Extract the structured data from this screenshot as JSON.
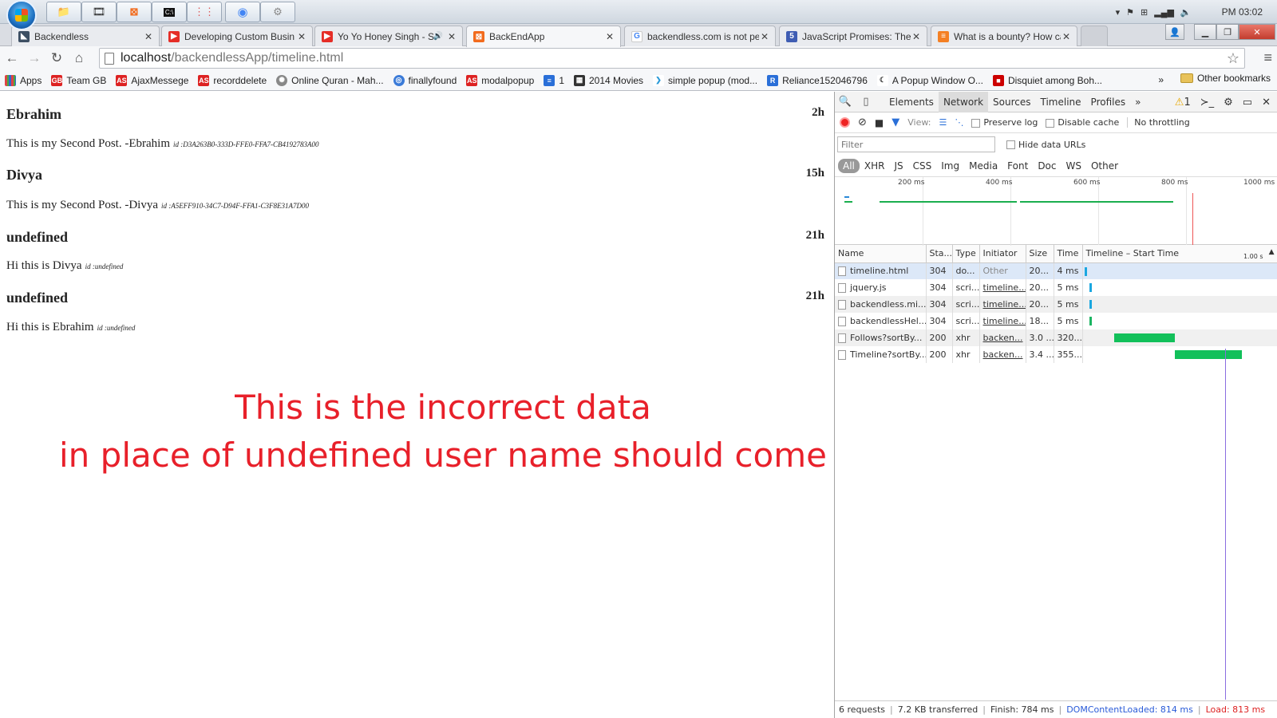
{
  "taskbar": {
    "buttons": [
      "folder-icon",
      "film-icon",
      "xampp-icon",
      "cmd-icon",
      "grid-icon",
      "chrome-icon",
      "tool-icon"
    ],
    "clock": "PM 03:02"
  },
  "tabs": [
    {
      "title": "Backendless",
      "favicon_color": "#3d4f63"
    },
    {
      "title": "Developing Custom Busin",
      "favicon_color": "#e52d27"
    },
    {
      "title": "Yo Yo Honey Singh - S",
      "favicon_color": "#e52d27"
    },
    {
      "title": "BackEndApp",
      "favicon_color": "#f26b1d"
    },
    {
      "title": "backendless.com is not pe",
      "favicon_color": "#4285f4"
    },
    {
      "title": "JavaScript Promises: There",
      "favicon_color": "#3f5db3"
    },
    {
      "title": "What is a bounty? How ca",
      "favicon_color": "#f48024"
    }
  ],
  "omnibox": {
    "host": "localhost",
    "path": "/backendlessApp/timeline.html"
  },
  "bookmarks": [
    {
      "label": "Apps",
      "color": "#d44"
    },
    {
      "label": "Team GB",
      "color": "#d22"
    },
    {
      "label": "AjaxMessege",
      "color": "#d22"
    },
    {
      "label": "recorddelete",
      "color": "#d22"
    },
    {
      "label": "Online Quran - Mah...",
      "color": "#888"
    },
    {
      "label": "finallyfound",
      "color": "#3b7bd8"
    },
    {
      "label": "modalpopup",
      "color": "#d22"
    },
    {
      "label": "1",
      "color": "#2a6fd8"
    },
    {
      "label": "2014 Movies",
      "color": "#333"
    },
    {
      "label": "simple popup (mod...",
      "color": "#2a9ad8"
    },
    {
      "label": "Reliance152046796",
      "color": "#2a6fd8"
    },
    {
      "label": "A Popup Window O...",
      "color": "#333"
    },
    {
      "label": "Disquiet among Boh...",
      "color": "#c00"
    }
  ],
  "bookmarks_other": "Other bookmarks",
  "posts": [
    {
      "name": "Ebrahim",
      "time": "2h",
      "body": "This is my Second Post. -Ebrahim",
      "id": "id :D3A263B0-333D-FFE0-FFA7-CB4192783A00"
    },
    {
      "name": "Divya",
      "time": "15h",
      "body": "This is my Second Post. -Divya",
      "id": "id :A5EFF910-34C7-D94F-FFA1-C3F8E31A7D00"
    },
    {
      "name": "undefined",
      "time": "21h",
      "body": "Hi this is Divya",
      "id": "id :undefined"
    },
    {
      "name": "undefined",
      "time": "21h",
      "body": "Hi this is Ebrahim",
      "id": "id :undefined"
    }
  ],
  "annotation": {
    "line1": "This is the incorrect data",
    "line2": "in place of undefined user name should come",
    "color": "#e8202a"
  },
  "devtools": {
    "tabs": [
      "Elements",
      "Network",
      "Sources",
      "Timeline",
      "Profiles"
    ],
    "active_tab": "Network",
    "more": "»",
    "warning_count": "1",
    "view_label": "View:",
    "preserve_log": "Preserve log",
    "disable_cache": "Disable cache",
    "throttling": "No throttling",
    "filter_placeholder": "Filter",
    "hide_data_urls": "Hide data URLs",
    "types": [
      "All",
      "XHR",
      "JS",
      "CSS",
      "Img",
      "Media",
      "Font",
      "Doc",
      "WS",
      "Other"
    ],
    "overview_ticks": [
      "200 ms",
      "400 ms",
      "600 ms",
      "800 ms",
      "1000 ms"
    ],
    "columns": [
      "Name",
      "Sta...",
      "Type",
      "Initiator",
      "Size",
      "Time",
      "Timeline – Start Time"
    ],
    "waterfall_scale": "1.00 s",
    "requests": [
      {
        "name": "timeline.html",
        "status": "304",
        "type": "do...",
        "initiator": "Other",
        "size": "20...",
        "time": "4 ms",
        "start": 0.01,
        "dur": 0.004,
        "color": "#1aa7e0"
      },
      {
        "name": "jquery.js",
        "status": "304",
        "type": "scri...",
        "initiator": "timeline...",
        "size": "20...",
        "time": "5 ms",
        "start": 0.035,
        "dur": 0.005,
        "color": "#1aa7e0"
      },
      {
        "name": "backendless.mi...",
        "status": "304",
        "type": "scri...",
        "initiator": "timeline...",
        "size": "20...",
        "time": "5 ms",
        "start": 0.035,
        "dur": 0.005,
        "color": "#1aa7e0"
      },
      {
        "name": "backendlessHel...",
        "status": "304",
        "type": "scri...",
        "initiator": "timeline...",
        "size": "18...",
        "time": "5 ms",
        "start": 0.035,
        "dur": 0.006,
        "color": "#1bb562"
      },
      {
        "name": "Follows?sortBy...",
        "status": "200",
        "type": "xhr",
        "initiator": "backen...",
        "size": "3.0 ...",
        "time": "320...",
        "start": 0.165,
        "dur": 0.32,
        "color": "#12c05a"
      },
      {
        "name": "Timeline?sortBy...",
        "status": "200",
        "type": "xhr",
        "initiator": "backen...",
        "size": "3.4 ...",
        "time": "355...",
        "start": 0.485,
        "dur": 0.355,
        "color": "#12c05a"
      }
    ],
    "footer": {
      "requests": "6 requests",
      "transferred": "7.2 KB transferred",
      "finish": "Finish: 784 ms",
      "domcontent": "DOMContentLoaded: 814 ms",
      "load": "Load: 813 ms"
    }
  }
}
